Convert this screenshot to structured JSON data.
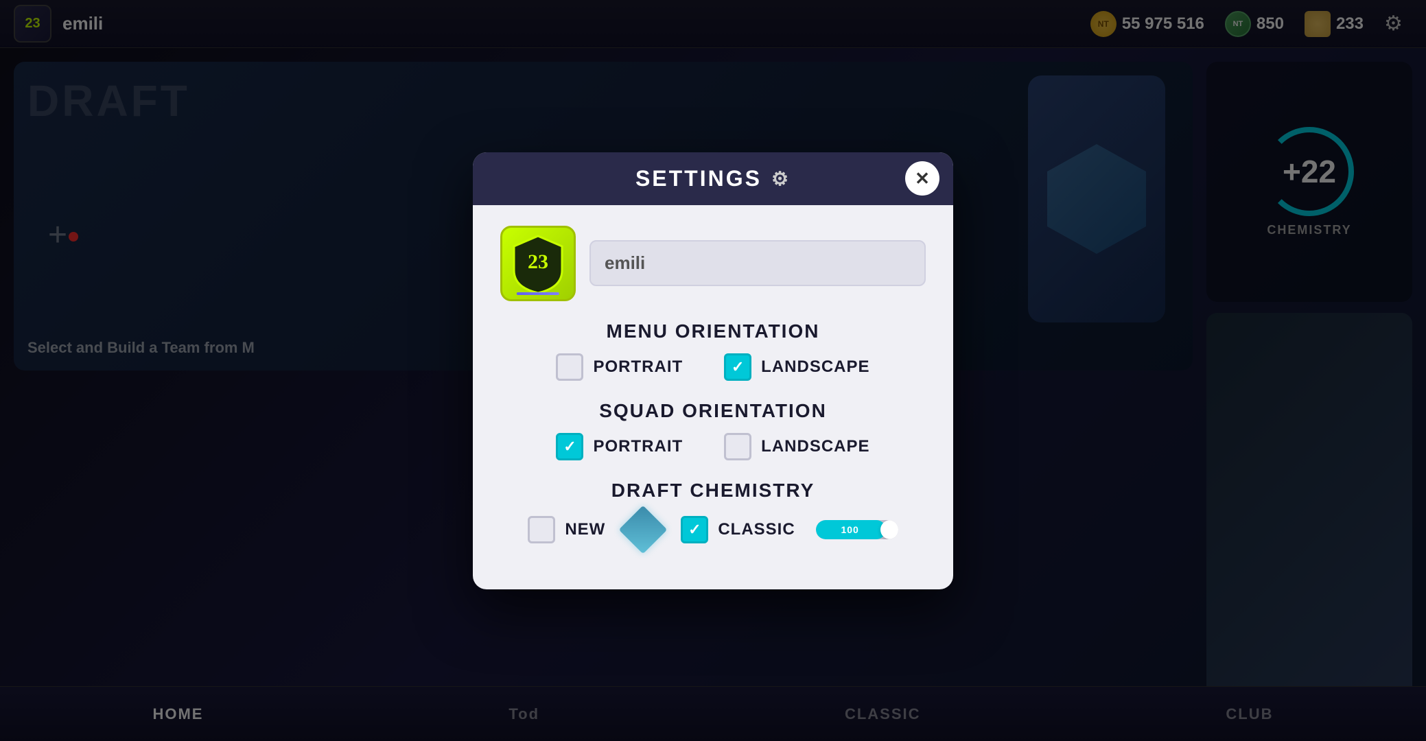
{
  "app": {
    "logo": "23",
    "username": "emili",
    "currency": {
      "coins": "55 975 516",
      "points": "850",
      "fifa_points": "233"
    },
    "coin_label": "NT",
    "top_bar_gear": "⚙"
  },
  "background": {
    "draft_label": "DRAFT",
    "draft_subtitle": "Select and Build a Team from M",
    "chemistry_value": "+22",
    "chemistry_label": "CHEMISTRY"
  },
  "nav": {
    "home": "HOME",
    "tod": "Tod",
    "classic": "CLASSIC",
    "club": "CLUB"
  },
  "modal": {
    "title": "SETTINGS",
    "title_gear": "⚙",
    "close_label": "✕",
    "username_placeholder": "emili",
    "menu_orientation": {
      "section_title": "MENU ORIENTATION",
      "portrait_label": "PORTRAIT",
      "portrait_checked": false,
      "landscape_label": "LANDSCAPE",
      "landscape_checked": true
    },
    "squad_orientation": {
      "section_title": "SQUAD ORIENTATION",
      "portrait_label": "PORTRAIT",
      "portrait_checked": true,
      "landscape_label": "LANDSCAPE",
      "landscape_checked": false
    },
    "draft_chemistry": {
      "section_title": "DRAFT CHEMISTRY",
      "new_label": "NEW",
      "new_checked": false,
      "classic_label": "CLASSIC",
      "classic_checked": true,
      "slider_value": "100",
      "slider_fill_pct": 85
    }
  }
}
